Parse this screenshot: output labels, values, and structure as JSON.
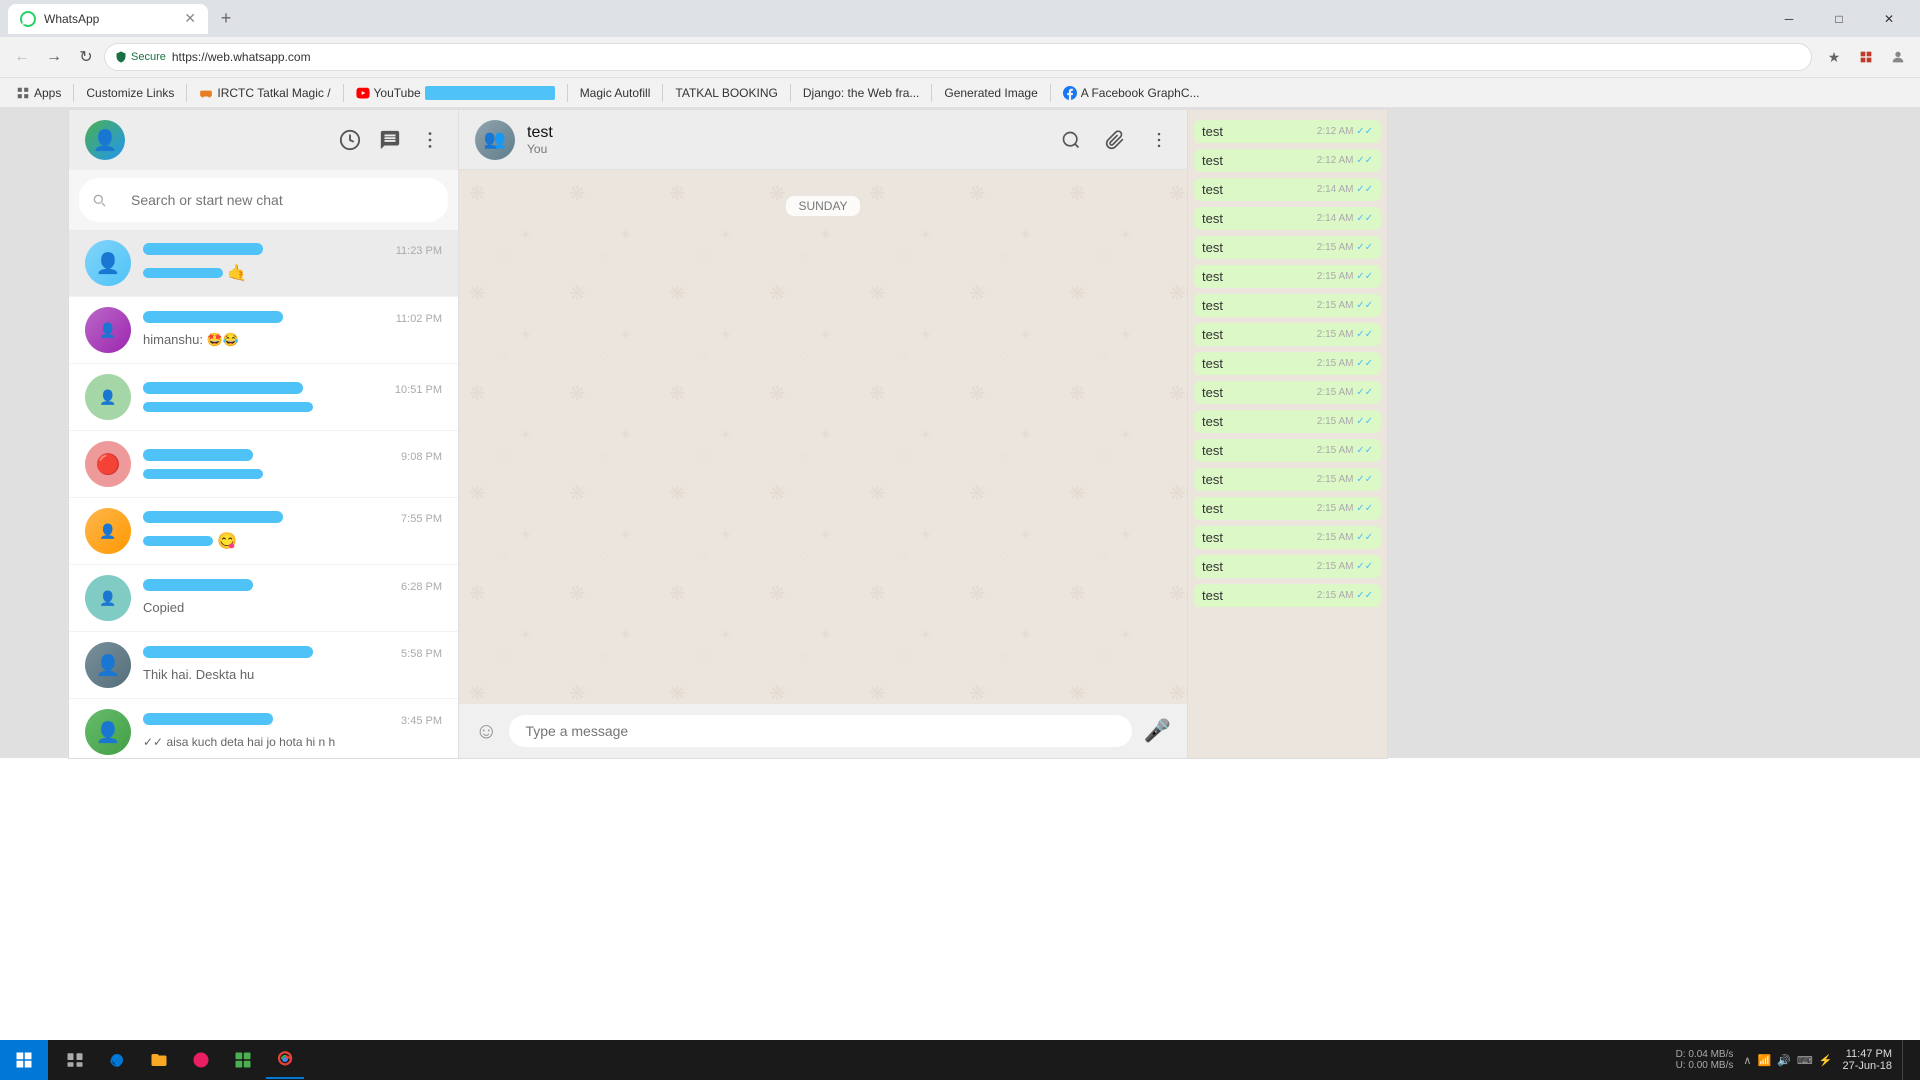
{
  "browser": {
    "tab": {
      "title": "WhatsApp",
      "favicon_color": "#25d366"
    },
    "address": "https://web.whatsapp.com",
    "secure_label": "Secure",
    "bookmarks": [
      {
        "label": "Apps",
        "icon": "grid"
      },
      {
        "label": "",
        "icon": "link"
      },
      {
        "label": "Customize Links",
        "icon": "link"
      },
      {
        "label": "",
        "icon": "irctc"
      },
      {
        "label": "IRCTC Tatkal Magic /",
        "icon": "train"
      },
      {
        "label": "",
        "icon": "yt"
      },
      {
        "label": "YouTube",
        "icon": "youtube",
        "has_bar": true
      },
      {
        "label": "",
        "icon": "magic"
      },
      {
        "label": "Magic Autofill",
        "icon": "magic"
      },
      {
        "label": "",
        "icon": "tatkal"
      },
      {
        "label": "TATKAL BOOKING",
        "icon": "booking"
      },
      {
        "label": "",
        "icon": "django"
      },
      {
        "label": "Django: the Web fra...",
        "icon": "django"
      },
      {
        "label": "",
        "icon": "img"
      },
      {
        "label": "Generated Image",
        "icon": "image"
      },
      {
        "label": "",
        "icon": "fb"
      },
      {
        "label": "A Facebook GraphC...",
        "icon": "facebook"
      }
    ]
  },
  "whatsapp": {
    "sidebar": {
      "search_placeholder": "Search or start new chat",
      "chat_items": [
        {
          "time": "11:23 PM",
          "preview": "",
          "emoji": "🤙"
        },
        {
          "time": "11:02 PM",
          "preview": "himanshu: 🤩😂"
        },
        {
          "time": "10:51 PM",
          "preview": ""
        },
        {
          "time": "9:08 PM",
          "preview": ""
        },
        {
          "time": "7:55 PM",
          "preview": "",
          "emoji": "😋"
        },
        {
          "time": "6:28 PM",
          "preview": "Copied"
        },
        {
          "time": "5:58 PM",
          "preview": "Thik hai. Deskta hu"
        },
        {
          "time": "3:45 PM",
          "preview": "✓✓ aisa kuch deta hai jo hota hi n h"
        }
      ]
    },
    "chat": {
      "contact_name": "test",
      "status": "You",
      "day_label": "SUNDAY",
      "messages": [
        {
          "text": "test",
          "time": "2:12 AM",
          "ticks": "✓✓"
        },
        {
          "text": "test",
          "time": "2:12 AM",
          "ticks": "✓✓"
        },
        {
          "text": "test",
          "time": "2:14 AM",
          "ticks": "✓✓"
        },
        {
          "text": "test",
          "time": "2:14 AM",
          "ticks": "✓✓"
        },
        {
          "text": "test",
          "time": "2:15 AM",
          "ticks": "✓✓"
        },
        {
          "text": "test",
          "time": "2:15 AM",
          "ticks": "✓✓"
        },
        {
          "text": "test",
          "time": "2:15 AM",
          "ticks": "✓✓"
        },
        {
          "text": "test",
          "time": "2:15 AM",
          "ticks": "✓✓"
        },
        {
          "text": "test",
          "time": "2:15 AM",
          "ticks": "✓✓"
        },
        {
          "text": "test",
          "time": "2:15 AM",
          "ticks": "✓✓"
        },
        {
          "text": "test",
          "time": "2:15 AM",
          "ticks": "✓✓"
        },
        {
          "text": "test",
          "time": "2:15 AM",
          "ticks": "✓✓"
        },
        {
          "text": "test",
          "time": "2:15 AM",
          "ticks": "✓✓"
        },
        {
          "text": "test",
          "time": "2:15 AM",
          "ticks": "✓✓"
        },
        {
          "text": "test",
          "time": "2:15 AM",
          "ticks": "✓✓"
        },
        {
          "text": "test",
          "time": "2:15 AM",
          "ticks": "✓✓"
        },
        {
          "text": "test",
          "time": "2:15 AM",
          "ticks": "✓✓"
        }
      ],
      "input_placeholder": "Type a message"
    }
  },
  "taskbar": {
    "time": "11:47 PM",
    "date": "27-Jun-18",
    "network_label": "D: 0.04 MB/s  U: 0.00 MB/s"
  },
  "window_controls": {
    "minimize": "─",
    "maximize": "□",
    "close": "✕"
  }
}
